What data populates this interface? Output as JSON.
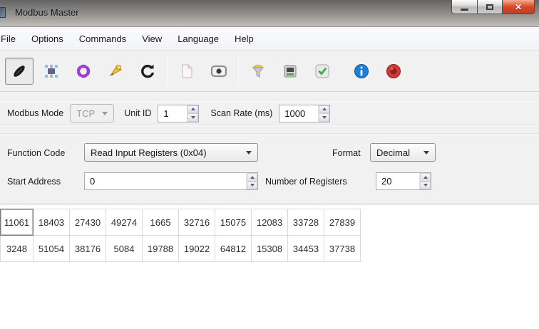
{
  "window": {
    "title": "Modbus Master",
    "controls": {
      "minimize": "minimize",
      "maximize": "maximize",
      "close": "close"
    }
  },
  "menu": {
    "items": [
      "File",
      "Options",
      "Commands",
      "View",
      "Language",
      "Help"
    ]
  },
  "toolbar": {
    "icons": [
      "connect",
      "poll-setup",
      "scan-loop",
      "alert-horn",
      "refresh",
      "new-log",
      "display",
      "lamp",
      "device",
      "ok-check",
      "info",
      "exit"
    ]
  },
  "mode_bar": {
    "modbus_mode_label": "Modbus Mode",
    "modbus_mode_value": "TCP",
    "unit_id_label": "Unit ID",
    "unit_id_value": "1",
    "scan_rate_label": "Scan Rate (ms)",
    "scan_rate_value": "1000"
  },
  "request": {
    "function_code_label": "Function Code",
    "function_code_value": "Read Input Registers (0x04)",
    "format_label": "Format",
    "format_value": "Decimal",
    "start_address_label": "Start Address",
    "start_address_value": "0",
    "number_of_registers_label": "Number of Registers",
    "number_of_registers_value": "20"
  },
  "registers": {
    "rows": [
      [
        "11061",
        "18403",
        "27430",
        "49274",
        "1665",
        "32716",
        "15075",
        "12083",
        "33728",
        "27839"
      ],
      [
        "3248",
        "51054",
        "38176",
        "5084",
        "19788",
        "19022",
        "64812",
        "15308",
        "34453",
        "37738"
      ]
    ]
  },
  "colors": {
    "close_button": "#d9502e",
    "info_blue": "#1f7fd4",
    "check_green": "#3faf46",
    "scan_purple": "#9b3fd0",
    "alert_yellow": "#edbf3b"
  }
}
